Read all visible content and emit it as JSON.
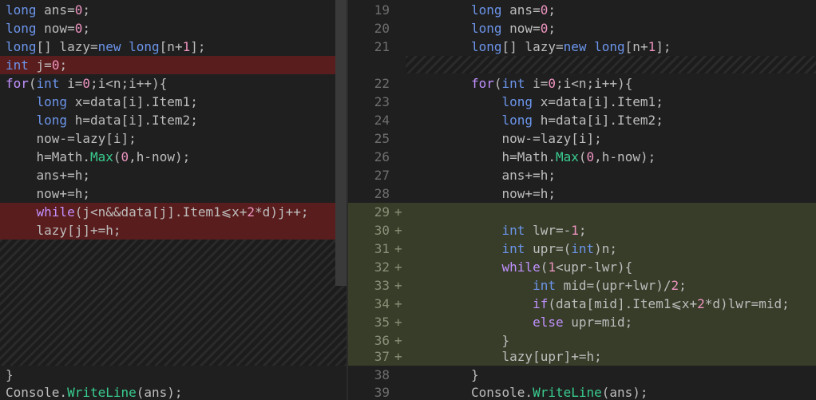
{
  "colors": {
    "background": "#1f1f1f",
    "deleted_line": "#5a1d1d",
    "added_line": "#373d29",
    "keyword": "#6c95eb",
    "control_keyword": "#c191ff",
    "number": "#ed94c0",
    "method": "#39cc8f",
    "text": "#bdbdbd",
    "line_number": "#6e6e6e"
  },
  "left": {
    "lines": [
      {
        "text": "long ans=0;",
        "kind": "normal"
      },
      {
        "text": "long now=0;",
        "kind": "normal"
      },
      {
        "text": "long[] lazy=new long[n+1];",
        "kind": "normal"
      },
      {
        "text": "int j=0;",
        "kind": "deleted"
      },
      {
        "text": "for(int i=0;i<n;i++){",
        "kind": "normal"
      },
      {
        "text": "    long x=data[i].Item1;",
        "kind": "normal"
      },
      {
        "text": "    long h=data[i].Item2;",
        "kind": "normal"
      },
      {
        "text": "    now-=lazy[i];",
        "kind": "normal"
      },
      {
        "text": "    h=Math.Max(0,h-now);",
        "kind": "normal"
      },
      {
        "text": "    ans+=h;",
        "kind": "normal"
      },
      {
        "text": "    now+=h;",
        "kind": "normal"
      },
      {
        "text": "    while(j<n&&data[j].Item1⩽x+2*d)j++;",
        "kind": "deleted"
      },
      {
        "text": "    lazy[j]+=h;",
        "kind": "deleted"
      },
      {
        "text": "}",
        "kind": "normal"
      },
      {
        "text": "Console.WriteLine(ans);",
        "kind": "normal"
      }
    ]
  },
  "right": {
    "lines": [
      {
        "num": "19",
        "mark": "",
        "text": "long ans=0;",
        "kind": "normal"
      },
      {
        "num": "20",
        "mark": "",
        "text": "long now=0;",
        "kind": "normal"
      },
      {
        "num": "21",
        "mark": "",
        "text": "long[] lazy=new long[n+1];",
        "kind": "normal"
      },
      {
        "num": "22",
        "mark": "",
        "text": "for(int i=0;i<n;i++){",
        "kind": "normal"
      },
      {
        "num": "23",
        "mark": "",
        "text": "    long x=data[i].Item1;",
        "kind": "normal"
      },
      {
        "num": "24",
        "mark": "",
        "text": "    long h=data[i].Item2;",
        "kind": "normal"
      },
      {
        "num": "25",
        "mark": "",
        "text": "    now-=lazy[i];",
        "kind": "normal"
      },
      {
        "num": "26",
        "mark": "",
        "text": "    h=Math.Max(0,h-now);",
        "kind": "normal"
      },
      {
        "num": "27",
        "mark": "",
        "text": "    ans+=h;",
        "kind": "normal"
      },
      {
        "num": "28",
        "mark": "",
        "text": "    now+=h;",
        "kind": "normal"
      },
      {
        "num": "29",
        "mark": "+",
        "text": "",
        "kind": "added"
      },
      {
        "num": "30",
        "mark": "+",
        "text": "    int lwr=-1;",
        "kind": "added"
      },
      {
        "num": "31",
        "mark": "+",
        "text": "    int upr=(int)n;",
        "kind": "added"
      },
      {
        "num": "32",
        "mark": "+",
        "text": "    while(1<upr-lwr){",
        "kind": "added"
      },
      {
        "num": "33",
        "mark": "+",
        "text": "        int mid=(upr+lwr)/2;",
        "kind": "added"
      },
      {
        "num": "34",
        "mark": "+",
        "text": "        if(data[mid].Item1⩽x+2*d)lwr=mid;",
        "kind": "added"
      },
      {
        "num": "35",
        "mark": "+",
        "text": "        else upr=mid;",
        "kind": "added"
      },
      {
        "num": "36",
        "mark": "+",
        "text": "    }",
        "kind": "added"
      },
      {
        "num": "37",
        "mark": "+",
        "text": "    lazy[upr]+=h;",
        "kind": "added"
      },
      {
        "num": "38",
        "mark": "",
        "text": "}",
        "kind": "normal"
      },
      {
        "num": "39",
        "mark": "",
        "text": "Console.WriteLine(ans);",
        "kind": "normal"
      }
    ]
  }
}
